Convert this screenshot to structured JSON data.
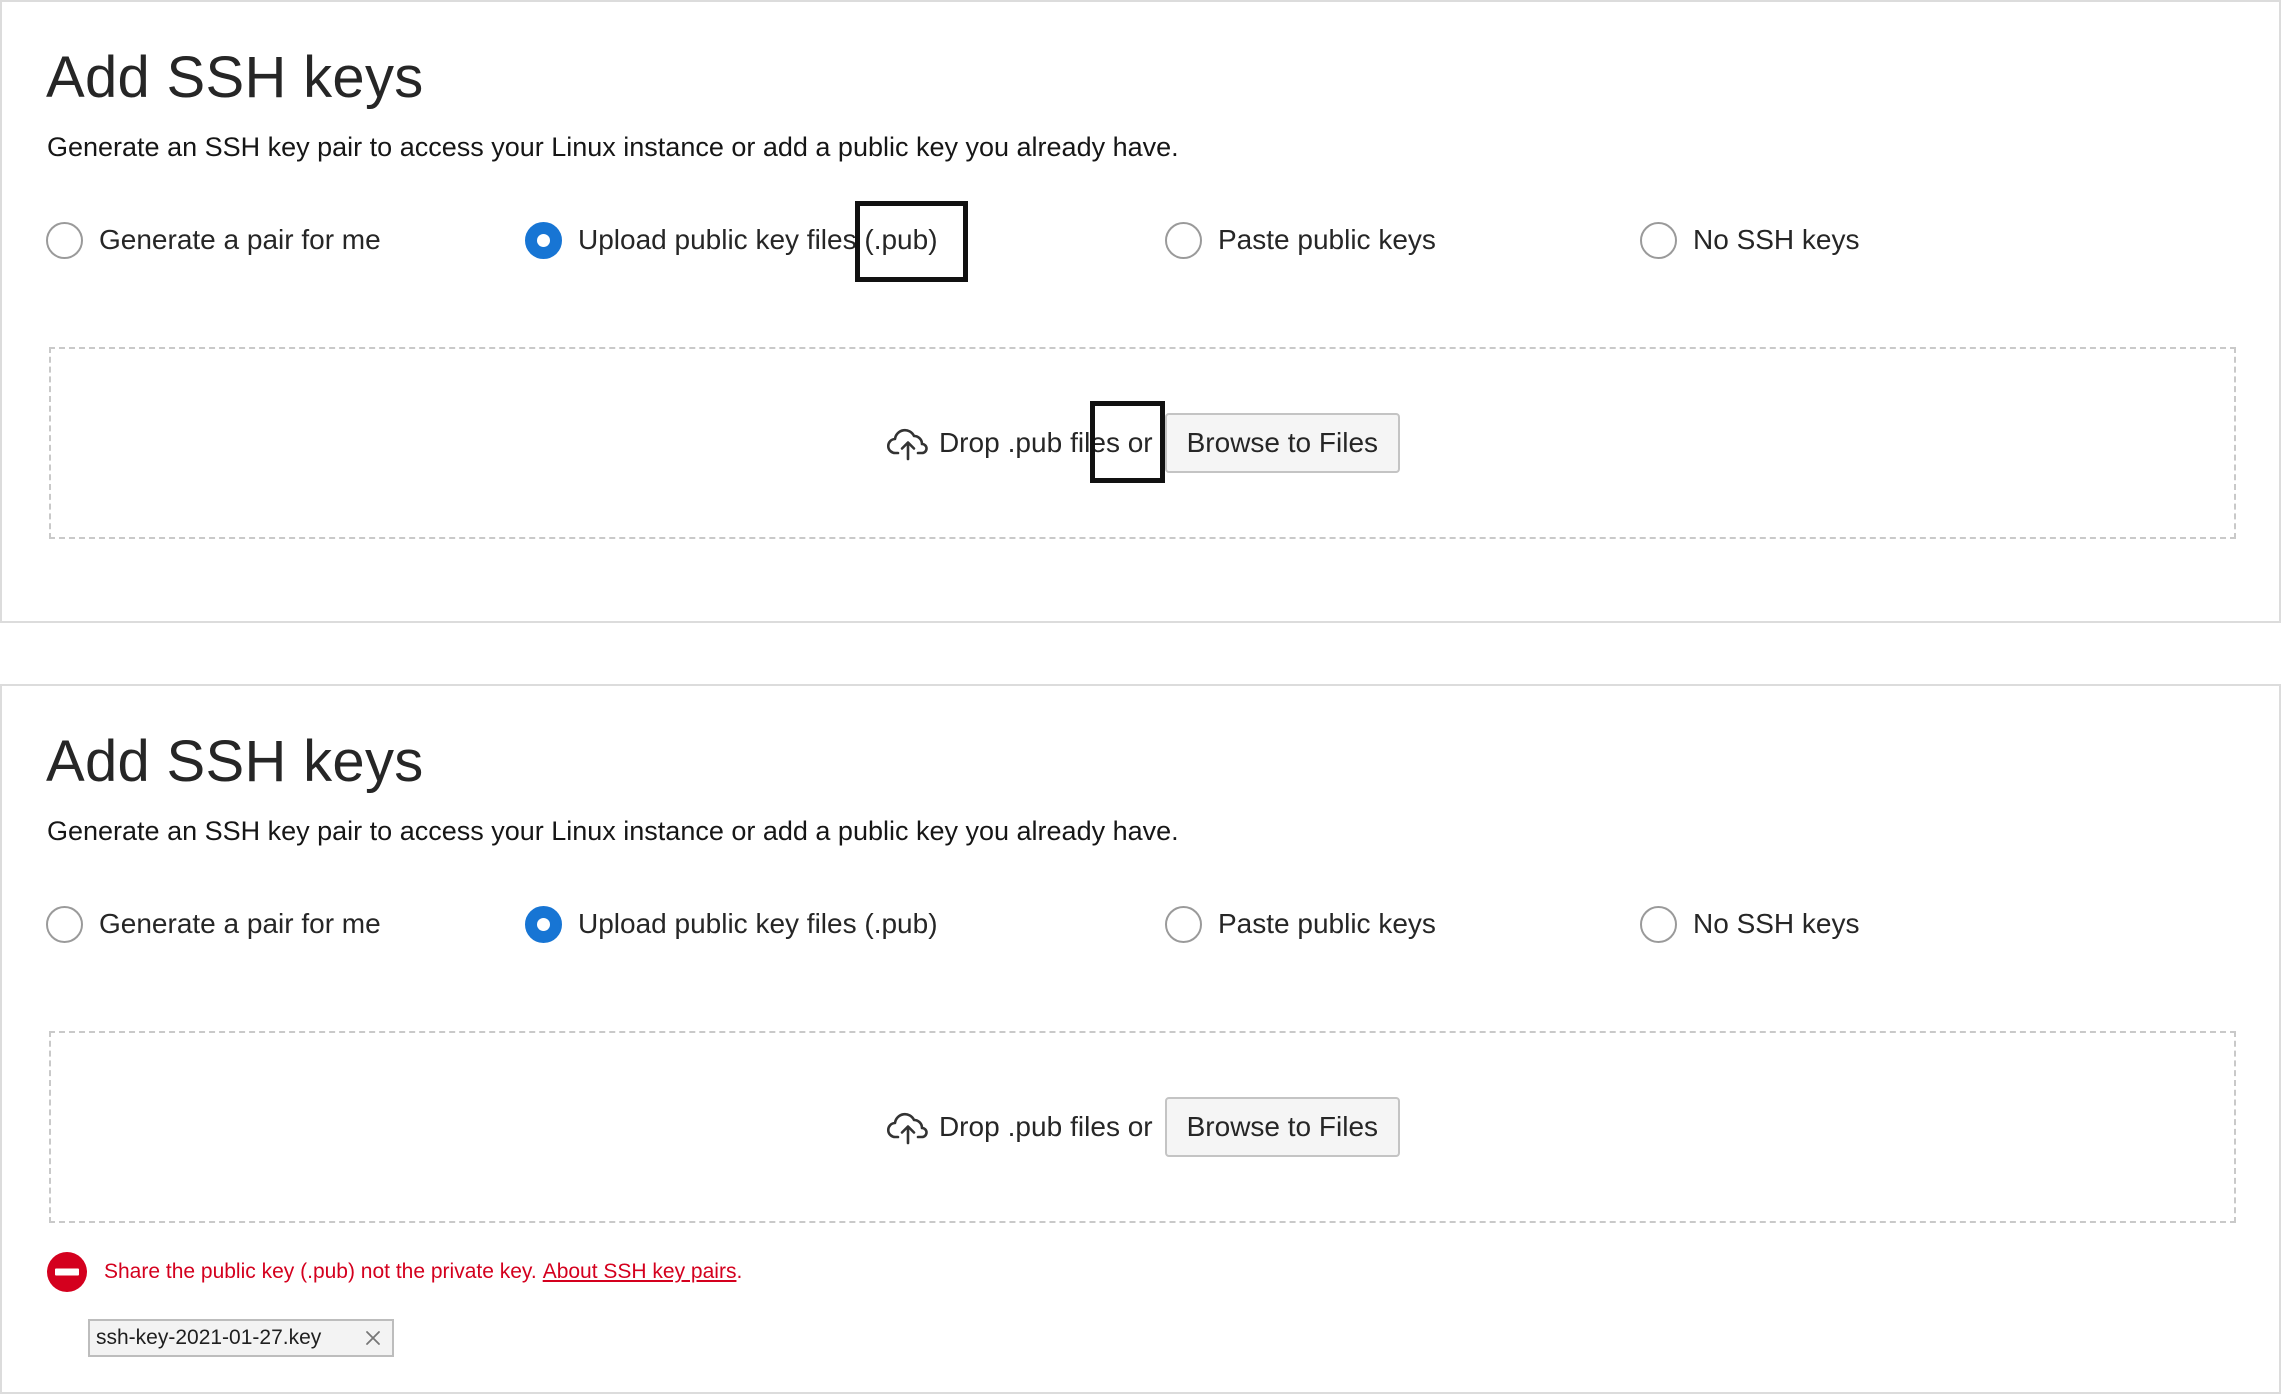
{
  "panels": [
    {
      "title": "Add SSH keys",
      "subtitle": "Generate an SSH key pair to access your Linux instance or add a public key you already have.",
      "options": [
        {
          "label": "Generate a pair for me",
          "selected": false
        },
        {
          "label": "Upload public key files (.pub)",
          "selected": true
        },
        {
          "label": "Paste public keys",
          "selected": false
        },
        {
          "label": "No SSH keys",
          "selected": false
        }
      ],
      "drop_prefix": "Drop",
      "drop_ext": ".pub",
      "drop_suffix": "files or",
      "browse_label": "Browse to Files",
      "cloud_icon": "cloud-upload-icon"
    },
    {
      "title": "Add SSH keys",
      "subtitle": "Generate an SSH key pair to access your Linux instance or add a public key you already have.",
      "options": [
        {
          "label": "Generate a pair for me",
          "selected": false
        },
        {
          "label": "Upload public key files (.pub)",
          "selected": true
        },
        {
          "label": "Paste public keys",
          "selected": false
        },
        {
          "label": "No SSH keys",
          "selected": false
        }
      ],
      "drop_prefix": "Drop",
      "drop_ext": ".pub",
      "drop_suffix": "files or",
      "browse_label": "Browse to Files",
      "cloud_icon": "cloud-upload-icon",
      "error": {
        "icon": "error-minus-icon",
        "text": "Share the public key (.pub) not the private key.",
        "link": "About SSH key pairs",
        "end": ".",
        "color": "#d4001e"
      },
      "file_chip": {
        "name": "ssh-key-2021-01-27.key",
        "close_icon": "close-icon"
      }
    }
  ],
  "colors": {
    "accent": "#1775d4",
    "error": "#d4001e",
    "border": "#dcdcdc"
  }
}
